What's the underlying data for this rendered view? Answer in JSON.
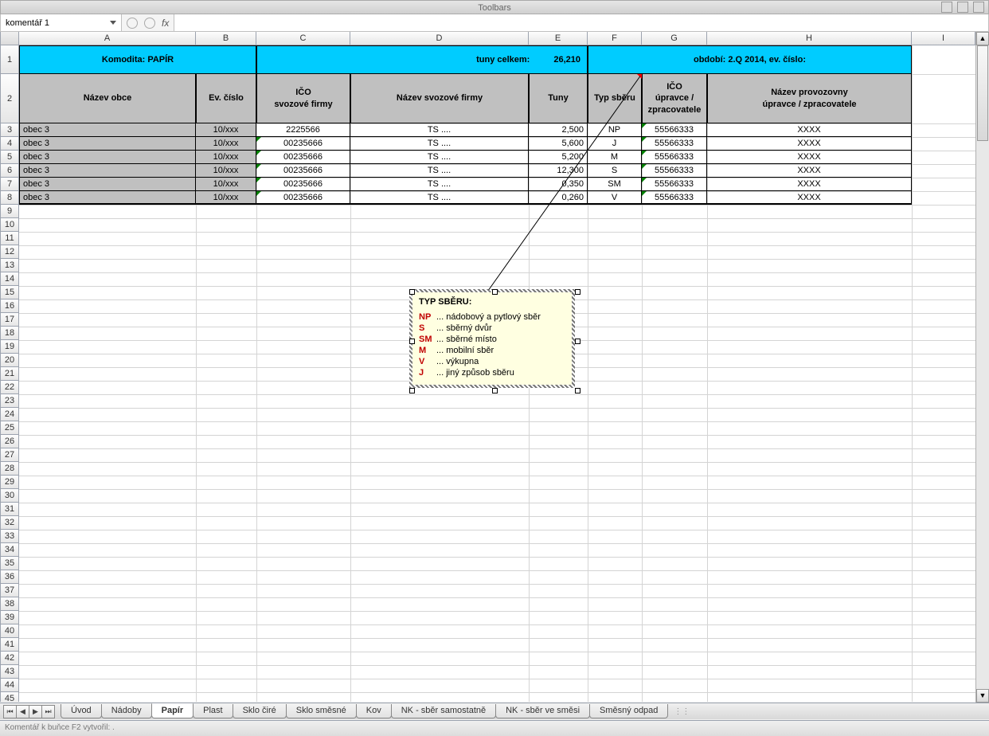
{
  "window": {
    "title": "Toolbars"
  },
  "formula_bar": {
    "name_box": "komentář 1",
    "fx_label": "fx",
    "value": ""
  },
  "columns": {
    "labels": [
      "A",
      "B",
      "C",
      "D",
      "E",
      "F",
      "G",
      "H",
      "I"
    ],
    "widths": [
      222,
      76,
      118,
      224,
      74,
      68,
      82,
      257,
      80
    ]
  },
  "row_numbers": [
    1,
    2,
    3,
    4,
    5,
    6,
    7,
    8,
    9,
    10,
    11,
    12,
    13,
    14,
    15,
    16,
    17,
    18,
    19,
    20,
    21,
    22,
    23,
    24,
    25,
    26,
    27,
    28,
    29,
    30,
    31,
    32,
    33,
    34,
    35,
    36,
    37,
    38,
    39,
    40,
    41,
    42,
    43,
    44,
    45
  ],
  "row1": {
    "komodita": "Komodita: PAPÍR",
    "tuny_celkem_label": "tuny celkem:",
    "tuny_celkem_val": "26,210",
    "obdobi": "období: 2.Q 2014,   ev. číslo:"
  },
  "headers": {
    "A": "Název obce",
    "B": "Ev. číslo",
    "C": "IČO\nsvozové firmy",
    "D": "Název svozové firmy",
    "E": "Tuny",
    "F": "Typ sběru",
    "G": "IČO\núpravce /\nzpracovatele",
    "H": "Název provozovny\núpravce / zpracovatele"
  },
  "data": [
    {
      "A": "obec 3",
      "B": "10/xxx",
      "C": "2225566",
      "D": "TS ....",
      "E": "2,500",
      "F": "NP",
      "G": "55566333",
      "H": "XXXX"
    },
    {
      "A": "obec 3",
      "B": "10/xxx",
      "C": "00235666",
      "D": "TS ....",
      "E": "5,600",
      "F": "J",
      "G": "55566333",
      "H": "XXXX"
    },
    {
      "A": "obec 3",
      "B": "10/xxx",
      "C": "00235666",
      "D": "TS ....",
      "E": "5,200",
      "F": "M",
      "G": "55566333",
      "H": "XXXX"
    },
    {
      "A": "obec 3",
      "B": "10/xxx",
      "C": "00235666",
      "D": "TS ....",
      "E": "12,300",
      "F": "S",
      "G": "55566333",
      "H": "XXXX"
    },
    {
      "A": "obec 3",
      "B": "10/xxx",
      "C": "00235666",
      "D": "TS ....",
      "E": "0,350",
      "F": "SM",
      "G": "55566333",
      "H": "XXXX"
    },
    {
      "A": "obec 3",
      "B": "10/xxx",
      "C": "00235666",
      "D": "TS ....",
      "E": "0,260",
      "F": "V",
      "G": "55566333",
      "H": "XXXX"
    }
  ],
  "comment": {
    "title": "TYP SBĚRU:",
    "rows": [
      {
        "code": "NP",
        "desc": "... nádobový a pytlový sběr"
      },
      {
        "code": "S",
        "desc": "... sběrný dvůr"
      },
      {
        "code": "SM",
        "desc": "... sběrné místo"
      },
      {
        "code": "M",
        "desc": "... mobilní sběr"
      },
      {
        "code": "V",
        "desc": "... výkupna"
      },
      {
        "code": "J",
        "desc": "... jiný způsob sběru"
      }
    ]
  },
  "tabs": [
    "Úvod",
    "Nádoby",
    "Papír",
    "Plast",
    "Sklo čiré",
    "Sklo směsné",
    "Kov",
    "NK - sběr samostatně",
    "NK - sběr ve směsi",
    "Směsný odpad"
  ],
  "active_tab": "Papír",
  "status": "Komentář k buňce F2 vytvořil: ."
}
